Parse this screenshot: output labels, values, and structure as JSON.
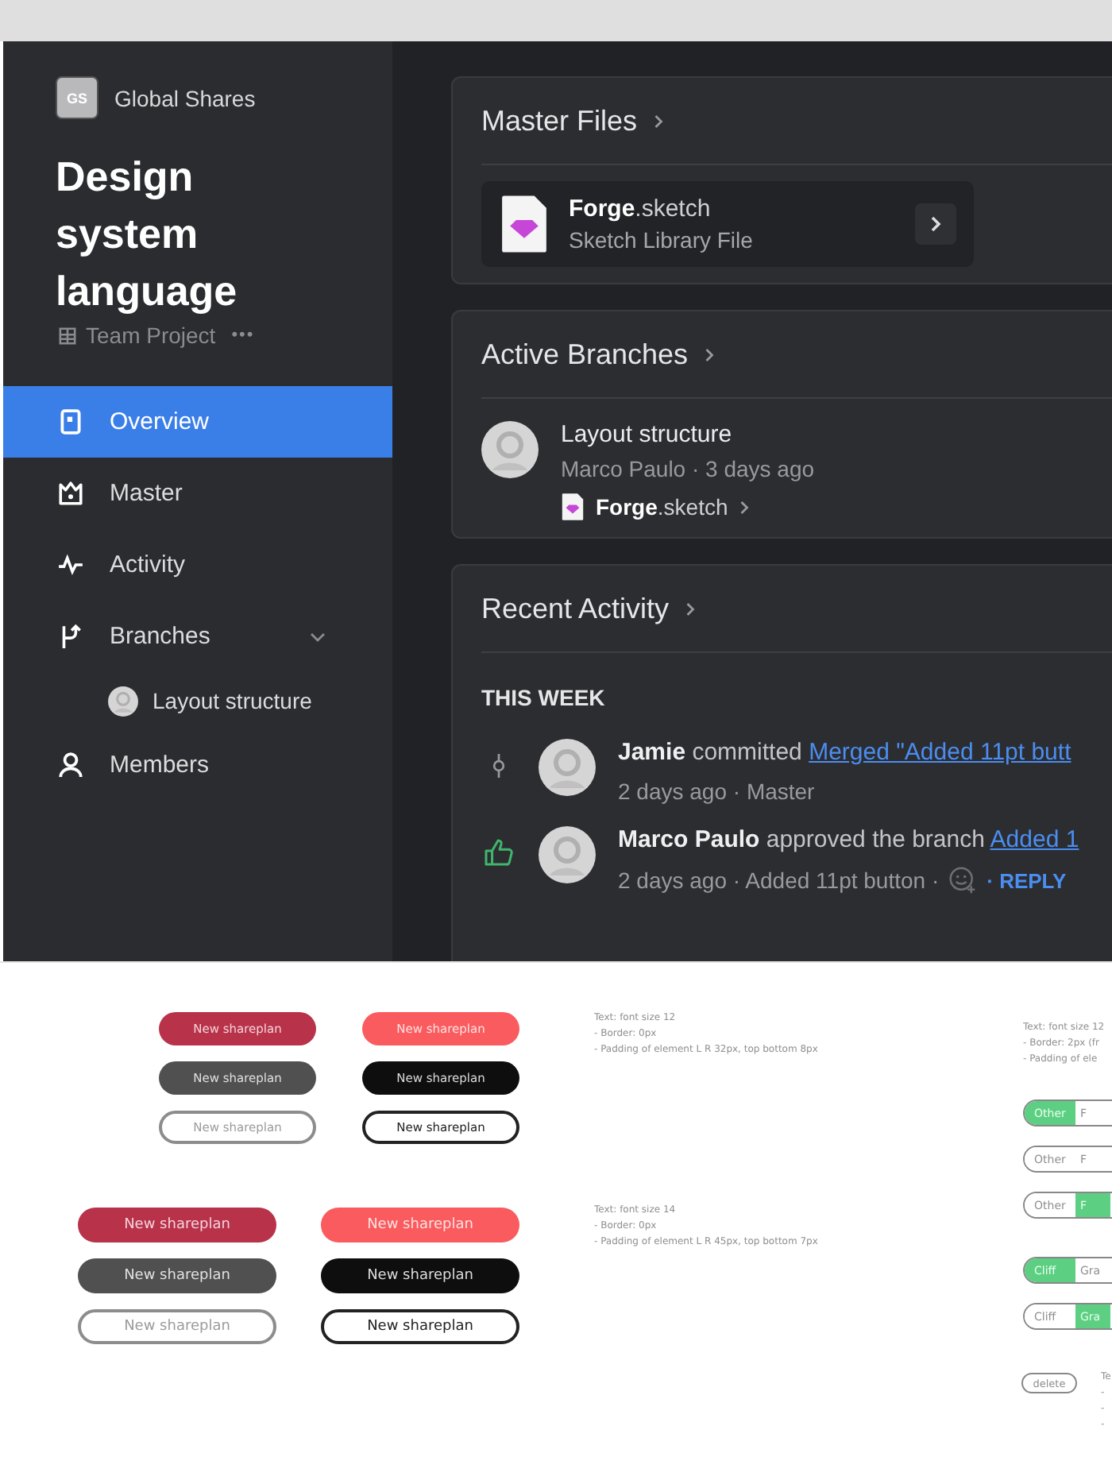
{
  "sidebar": {
    "org": {
      "initials": "GS",
      "name": "Global Shares"
    },
    "title": "Design system language",
    "project": {
      "label": "Team Project",
      "more": "•••"
    },
    "items": [
      {
        "kind": "overview",
        "label": "Overview",
        "selected": true
      },
      {
        "kind": "master",
        "label": "Master",
        "selected": false
      },
      {
        "kind": "activity",
        "label": "Activity",
        "selected": false
      },
      {
        "kind": "branches",
        "label": "Branches",
        "selected": false,
        "expanded": true,
        "children": [
          {
            "label": "Layout structure",
            "selected": false
          }
        ]
      },
      {
        "kind": "members",
        "label": "Members",
        "selected": false
      }
    ]
  },
  "master_files": {
    "title": "Master Files",
    "file": {
      "name": "Forge",
      "ext": ".sketch",
      "subtitle": "Sketch Library File"
    }
  },
  "active_branches": {
    "title": "Active Branches",
    "branch": {
      "name": "Layout structure",
      "meta": "Marco Paulo · 3 days ago",
      "file": {
        "name": "Forge",
        "ext": ".sketch"
      }
    }
  },
  "recent_activity": {
    "title": "Recent Activity",
    "group": "THIS WEEK",
    "items": [
      {
        "kind": "commit",
        "author": "Jamie",
        "action": "committed",
        "link": "Merged \"Added 11pt butt",
        "meta": "2 days ago · Master"
      },
      {
        "kind": "approve",
        "author": "Marco Paulo",
        "action": "approved the branch",
        "link": "Added 1",
        "meta": "2 days ago · Added 11pt button ·",
        "reaction": true,
        "reply": "· REPLY"
      }
    ]
  },
  "spec": {
    "small_buttons": [
      {
        "kind": "crimson",
        "label": "New shareplan"
      },
      {
        "kind": "coral",
        "label": "New shareplan"
      },
      {
        "kind": "grey",
        "label": "New shareplan"
      },
      {
        "kind": "black",
        "label": "New shareplan"
      },
      {
        "kind": "outline-light",
        "label": "New shareplan"
      },
      {
        "kind": "outline-dark",
        "label": "New shareplan"
      }
    ],
    "small_notes": [
      "Text: font size 12",
      "- Border: 0px",
      "- Padding of element L R 32px, top bottom 8px"
    ],
    "large_buttons": [
      {
        "kind": "crimson",
        "label": "New shareplan"
      },
      {
        "kind": "coral",
        "label": "New shareplan"
      },
      {
        "kind": "grey",
        "label": "New shareplan"
      },
      {
        "kind": "black",
        "label": "New shareplan"
      },
      {
        "kind": "outline-light",
        "label": "New shareplan"
      },
      {
        "kind": "outline-dark",
        "label": "New shareplan"
      }
    ],
    "large_notes": [
      "Text: font size 14",
      "- Border: 0px",
      "- Padding of element L R 45px, top bottom 7px"
    ],
    "toggle_notes": [
      "Text: font size 12",
      "- Border: 2px (fr",
      "- Padding of ele"
    ],
    "toggles": [
      {
        "options": [
          {
            "label": "Other",
            "selected": true
          },
          {
            "label": "F",
            "selected": false
          }
        ]
      },
      {
        "options": [
          {
            "label": "Other",
            "selected": false
          },
          {
            "label": "F",
            "selected": false
          }
        ]
      },
      {
        "options": [
          {
            "label": "Other",
            "selected": false
          },
          {
            "label": "F",
            "selected": true
          }
        ]
      },
      {
        "options": [
          {
            "label": "Cliff",
            "selected": true
          },
          {
            "label": "Gra",
            "selected": false
          }
        ]
      },
      {
        "options": [
          {
            "label": "Cliff",
            "selected": false
          },
          {
            "label": "Gra",
            "selected": true
          }
        ]
      }
    ],
    "delete_button": "delete",
    "delete_notes": [
      "Te",
      "-",
      "-",
      "-"
    ]
  }
}
